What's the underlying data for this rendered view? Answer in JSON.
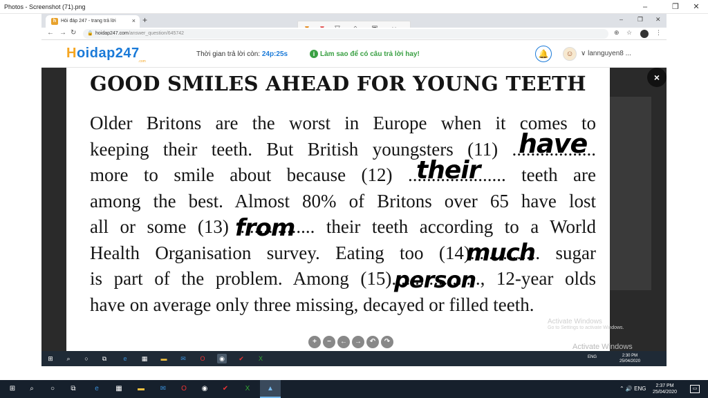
{
  "photos_window": {
    "title": "Photos - Screenshot (71).png",
    "minimize": "–",
    "maximize": "❐",
    "close": "✕"
  },
  "browser": {
    "tab_title": "Hỏi đáp 247 - trang trả lời",
    "tab_close": "×",
    "new_tab": "+",
    "url_domain": "hoidap247.com",
    "url_path": "/answer_question/645742",
    "window_min": "–",
    "window_max": "❐",
    "window_close": "✕"
  },
  "markup_toolbar": {
    "close": "×"
  },
  "site": {
    "logo_h": "H",
    "logo_rest": "oidap247",
    "logo_sub": ".com",
    "timer_label": "Thời gian trả lời còn: ",
    "timer_value": "24p:25s",
    "howto_text": "Làm sao để có câu trả lời hay!",
    "username": "lannguyen8 ..."
  },
  "lightbox": {
    "close": "×"
  },
  "worksheet": {
    "heading": "GOOD SMILES AHEAD FOR YOUNG TEETH",
    "lines": [
      "Older Britons are the worst in Europe when it comes to",
      "keeping their teeth. But British youngsters (11) ..................",
      "more to smile about because (12) ..................... teeth are",
      "among the best. Almost 80% of Britons over 65 have lost",
      "all or some (13) ................ their teeth according to a World",
      "Health Organisation survey. Eating too (14)............... sugar",
      "is part of the problem. Among (15)..................., 12-year olds",
      "have on average only three missing, decayed or filled teeth."
    ],
    "handwritten": {
      "a11": "have",
      "a12": "their",
      "a13": "from",
      "a14": "much",
      "a15": "person"
    }
  },
  "watermarks": {
    "activate_title": "Activate Windows",
    "activate_sub": "Go to Settings to activate Windows."
  },
  "viewer_controls": [
    "+",
    "−",
    "←",
    "→",
    "↶",
    "↷"
  ],
  "inner_taskbar": {
    "lang": "ENG",
    "time": "2:30 PM",
    "date": "25/04/2020"
  },
  "taskbar": {
    "lang": "ENG",
    "time": "2:37 PM",
    "date": "25/04/2020"
  }
}
